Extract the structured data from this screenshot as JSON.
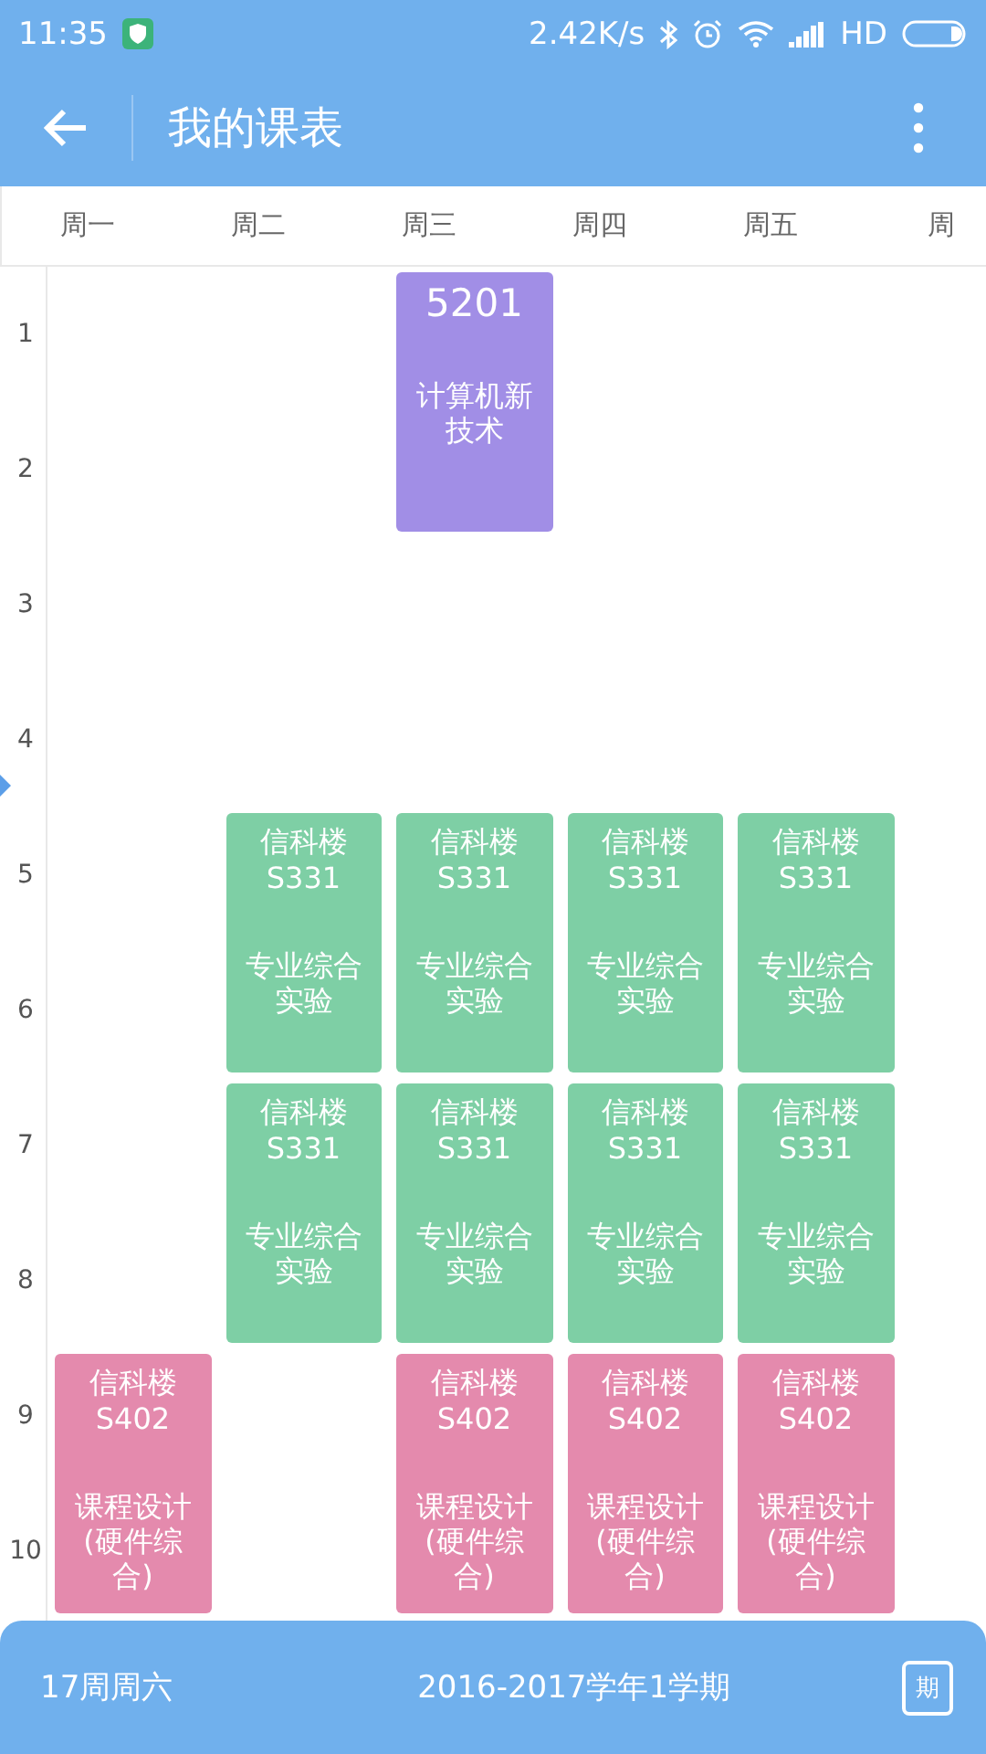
{
  "status_bar": {
    "time": "11:35",
    "speed": "2.42K/s",
    "network": "HD"
  },
  "toolbar": {
    "title": "我的课表"
  },
  "days": [
    {
      "label": "周一",
      "slots": [
        {
          "kind": "empty"
        },
        {
          "kind": "empty"
        },
        {
          "kind": "empty"
        },
        {
          "kind": "empty"
        },
        {
          "kind": "course",
          "color": "#e48aad",
          "location_lines": [
            "信科楼",
            "S402"
          ],
          "name": "课程设计(硬件综合)"
        }
      ]
    },
    {
      "label": "周二",
      "slots": [
        {
          "kind": "empty"
        },
        {
          "kind": "empty"
        },
        {
          "kind": "course",
          "color": "#7ecfa5",
          "location_lines": [
            "信科楼",
            "S331"
          ],
          "name": "专业综合实验"
        },
        {
          "kind": "course",
          "color": "#7ecfa5",
          "location_lines": [
            "信科楼",
            "S331"
          ],
          "name": "专业综合实验"
        },
        {
          "kind": "empty"
        }
      ]
    },
    {
      "label": "周三",
      "slots": [
        {
          "kind": "course",
          "color": "#a18ee6",
          "location_lines": [
            "5201"
          ],
          "name": "计算机新技术"
        },
        {
          "kind": "empty"
        },
        {
          "kind": "course",
          "color": "#7ecfa5",
          "location_lines": [
            "信科楼",
            "S331"
          ],
          "name": "专业综合实验"
        },
        {
          "kind": "course",
          "color": "#7ecfa5",
          "location_lines": [
            "信科楼",
            "S331"
          ],
          "name": "专业综合实验"
        },
        {
          "kind": "course",
          "color": "#e48aad",
          "location_lines": [
            "信科楼",
            "S402"
          ],
          "name": "课程设计(硬件综合)"
        }
      ]
    },
    {
      "label": "周四",
      "slots": [
        {
          "kind": "empty"
        },
        {
          "kind": "empty"
        },
        {
          "kind": "course",
          "color": "#7ecfa5",
          "location_lines": [
            "信科楼",
            "S331"
          ],
          "name": "专业综合实验"
        },
        {
          "kind": "course",
          "color": "#7ecfa5",
          "location_lines": [
            "信科楼",
            "S331"
          ],
          "name": "专业综合实验"
        },
        {
          "kind": "course",
          "color": "#e48aad",
          "location_lines": [
            "信科楼",
            "S402"
          ],
          "name": "课程设计(硬件综合)"
        }
      ]
    },
    {
      "label": "周五",
      "slots": [
        {
          "kind": "empty"
        },
        {
          "kind": "empty"
        },
        {
          "kind": "course",
          "color": "#7ecfa5",
          "location_lines": [
            "信科楼",
            "S331"
          ],
          "name": "专业综合实验"
        },
        {
          "kind": "course",
          "color": "#7ecfa5",
          "location_lines": [
            "信科楼",
            "S331"
          ],
          "name": "专业综合实验"
        },
        {
          "kind": "course",
          "color": "#e48aad",
          "location_lines": [
            "信科楼",
            "S402"
          ],
          "name": "课程设计(硬件综合)"
        }
      ]
    },
    {
      "label": "周",
      "slots": [
        {
          "kind": "empty"
        },
        {
          "kind": "empty"
        },
        {
          "kind": "empty"
        },
        {
          "kind": "empty"
        },
        {
          "kind": "empty"
        }
      ]
    }
  ],
  "periods": [
    "1",
    "2",
    "3",
    "4",
    "5",
    "6",
    "7",
    "8",
    "9",
    "10"
  ],
  "bottom_bar": {
    "week": "17周周六",
    "term": "2016-2017学年1学期",
    "term_button": "期"
  }
}
